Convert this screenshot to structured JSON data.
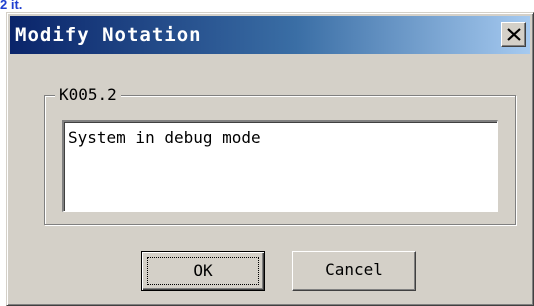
{
  "page": {
    "top_fragment": "2 it."
  },
  "dialog": {
    "title": "Modify Notation",
    "close_label": "×",
    "group": {
      "label": "K005.2",
      "text": "System in debug mode"
    },
    "buttons": {
      "ok": "OK",
      "cancel": "Cancel"
    }
  },
  "colors": {
    "titlebar_start": "#0a246a",
    "titlebar_end": "#a6caf0",
    "face": "#d4d0c8",
    "link_fragment": "#1f3fd0"
  },
  "icons": {
    "close": "close-icon"
  }
}
